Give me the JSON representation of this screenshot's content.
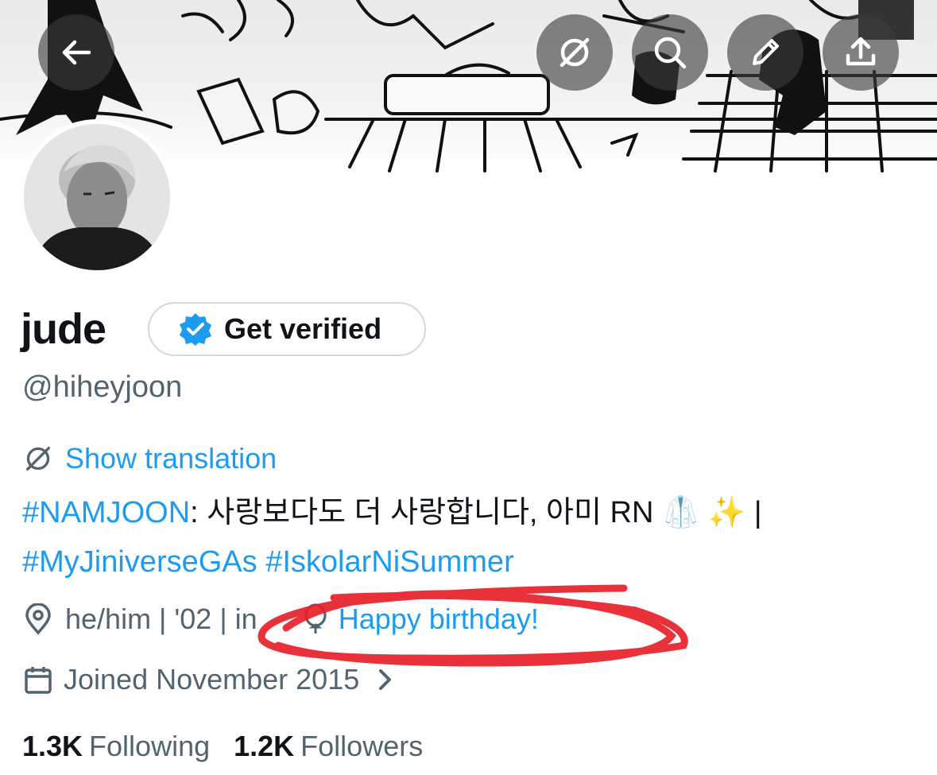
{
  "header": {
    "buttons": [
      {
        "name": "back-button",
        "icon": "back-arrow-icon"
      },
      {
        "name": "translate-button",
        "icon": "translate-icon"
      },
      {
        "name": "search-button",
        "icon": "search-icon"
      },
      {
        "name": "edit-button",
        "icon": "pencil-icon"
      },
      {
        "name": "share-button",
        "icon": "share-icon"
      }
    ]
  },
  "profile": {
    "display_name": "jude",
    "verify_label": "Get verified",
    "handle": "@hiheyjoon",
    "show_translation": "Show translation",
    "bio": {
      "tag1": "#NAMJOON",
      "text1": ": 사랑보다도 더 사랑합니다, 아미 RN",
      "emojis": "🥼 ✨",
      "separator": " |",
      "tag2": "#MyJiniverseGAs",
      "tag3": "#IskolarNiSummer"
    },
    "location": "he/him | '02 | in",
    "birthday": "Happy birthday!",
    "joined": "Joined November 2015",
    "following_count": "1.3K",
    "following_label": "Following",
    "followers_count": "1.2K",
    "followers_label": "Followers"
  },
  "colors": {
    "accent": "#1d9bf0",
    "secondary_text": "#536471",
    "annotation_red": "#e8202a"
  }
}
